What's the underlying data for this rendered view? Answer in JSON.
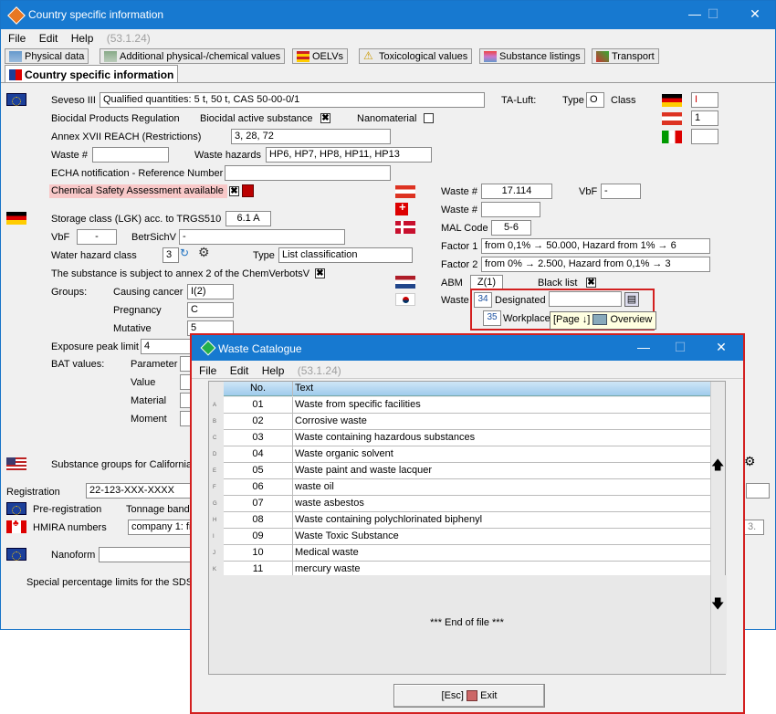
{
  "window": {
    "title": "Country specific information",
    "minimize": "—",
    "maximize": "☐",
    "close": "✕"
  },
  "menu": {
    "file": "File",
    "edit": "Edit",
    "help": "Help",
    "version": "(53.1.24)"
  },
  "tabs": [
    {
      "label": "Physical data",
      "icon": "flask-icon"
    },
    {
      "label": "Additional physical-/chemical values",
      "icon": "flask-icon"
    },
    {
      "label": "OELVs",
      "icon": "table-icon"
    },
    {
      "label": "Toxicological values",
      "icon": "warning-icon"
    },
    {
      "label": "Substance listings",
      "icon": "stack-icon"
    },
    {
      "label": "Transport",
      "icon": "transport-icon"
    }
  ],
  "active_tab": {
    "label": "Country specific information"
  },
  "eu": {
    "seveso_label": "Seveso III",
    "seveso_value": "Qualified quantities: 5 t, 50 t, CAS 50-00-0/1",
    "biocidal_label": "Biocidal Products Regulation",
    "biocidal_active_label": "Biocidal active substance",
    "biocidal_active_checked": "✖",
    "nanomaterial_label": "Nanomaterial",
    "annex_label": "Annex XVII REACH (Restrictions)",
    "annex_value": "3, 28, 72",
    "waste_no_label": "Waste #",
    "waste_hazards_label": "Waste hazards",
    "waste_hazards_value": "HP6, HP7, HP8, HP11, HP13",
    "echa_label": "ECHA notification - Reference Number",
    "csa_label": "Chemical Safety Assessment available",
    "csa_checked": "✖"
  },
  "taluft": {
    "label": "TA-Luft:",
    "type_label": "Type",
    "type_value": "O",
    "class_label": "Class",
    "class_de": "I",
    "class_at": "1"
  },
  "de": {
    "storage_label": "Storage class (LGK) acc. to TRGS510",
    "storage_value": "6.1 A",
    "vbf_label": "VbF",
    "vbf_value": "-",
    "betr_label": "BetrSichV",
    "betr_value": "-",
    "whc_label": "Water hazard class",
    "whc_value": "3",
    "type_label": "Type",
    "type_value": "List classification",
    "chemverbots_label": "The substance is subject to annex 2 of the ChemVerbotsV",
    "chemverbots_checked": "✖",
    "groups_label": "Groups:",
    "causing_cancer_label": "Causing cancer",
    "causing_cancer_value": "I(2)",
    "pregnancy_label": "Pregnancy",
    "pregnancy_value": "C",
    "mutative_label": "Mutative",
    "mutative_value": "5",
    "exposure_label": "Exposure peak limit",
    "exposure_value": "4",
    "bat_label": "BAT values:",
    "parameter_label": "Parameter",
    "value_label": "Value",
    "material_label": "Material",
    "moment_label": "Moment"
  },
  "at": {
    "waste_label": "Waste #",
    "waste_value": "17.114",
    "vbf_label": "VbF",
    "vbf_value": "-"
  },
  "ch": {
    "waste_label": "Waste #"
  },
  "dk": {
    "mal_label": "MAL Code",
    "mal_value": "5-6",
    "factor1_label": "Factor 1",
    "factor1_value": "from 0,1% → 50.000, Hazard from 1% → 6",
    "factor2_label": "Factor 2",
    "factor2_value": "from 0% → 2.500, Hazard from 0,1% → 3"
  },
  "nl": {
    "abm_label": "ABM",
    "abm_value": "Z(1)",
    "blacklist_label": "Black list",
    "blacklist_checked": "✖"
  },
  "kr": {
    "waste_label": "Waste",
    "designated_no": "34",
    "designated_label": "Designated",
    "workplace_no": "35",
    "workplace_label": "Workplace",
    "tooltip_page": "[Page ↓]",
    "tooltip_overview": "Overview"
  },
  "us": {
    "label": "Substance groups for California"
  },
  "registration": {
    "label": "Registration",
    "value": "22-123-XXX-XXXX",
    "prereg_label": "Pre-registration",
    "tonnage_label": "Tonnage band",
    "hmira_label": "HMIRA numbers",
    "hmira_value": "company 1: fil",
    "hmira_tail": "3.",
    "nanoform_label": "Nanoform",
    "special_label": "Special percentage limits for the SDS"
  },
  "catalogue": {
    "title": "Waste Catalogue",
    "menu_file": "File",
    "menu_edit": "Edit",
    "menu_help": "Help",
    "version": "(53.1.24)",
    "col_no": "No.",
    "col_text": "Text",
    "rows": [
      {
        "key": "A",
        "no": "01",
        "text": "Waste from specific facilities"
      },
      {
        "key": "B",
        "no": "02",
        "text": "Corrosive waste"
      },
      {
        "key": "C",
        "no": "03",
        "text": "Waste containing hazardous substances"
      },
      {
        "key": "D",
        "no": "04",
        "text": "Waste organic solvent"
      },
      {
        "key": "E",
        "no": "05",
        "text": "Waste paint and waste lacquer"
      },
      {
        "key": "F",
        "no": "06",
        "text": "waste oil"
      },
      {
        "key": "G",
        "no": "07",
        "text": "waste asbestos"
      },
      {
        "key": "H",
        "no": "08",
        "text": "Waste containing polychlorinated biphenyl"
      },
      {
        "key": "I",
        "no": "09",
        "text": "Waste Toxic Substance"
      },
      {
        "key": "J",
        "no": "10",
        "text": "Medical waste"
      },
      {
        "key": "K",
        "no": "11",
        "text": "mercury waste"
      }
    ],
    "eof": "*** End of file ***",
    "exit_label": "[Esc]",
    "exit_text": "Exit"
  }
}
